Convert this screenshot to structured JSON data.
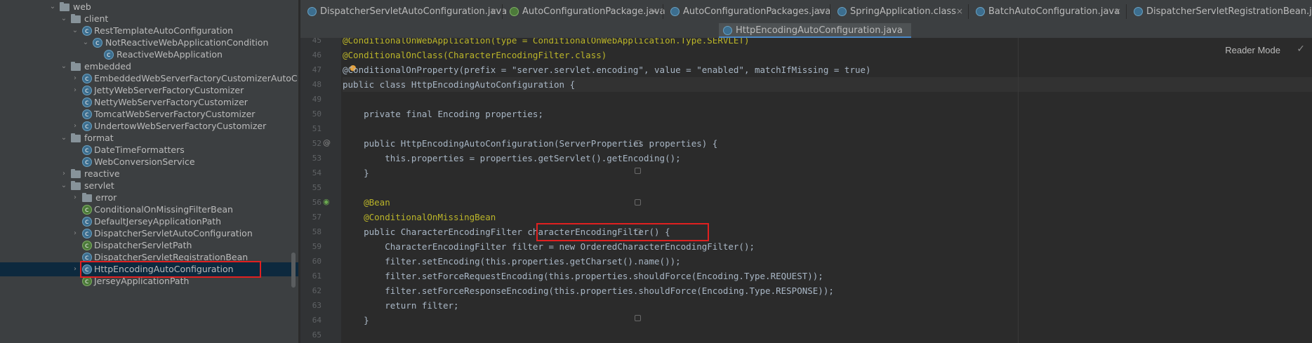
{
  "sidebar": {
    "items": [
      {
        "label": "web",
        "type": "folder",
        "expanded": true
      },
      {
        "label": "client",
        "type": "folder",
        "expanded": true
      },
      {
        "label": "RestTemplateAutoConfiguration",
        "type": "class",
        "expanded": true
      },
      {
        "label": "NotReactiveWebApplicationCondition",
        "type": "class",
        "expanded": true
      },
      {
        "label": "ReactiveWebApplication",
        "type": "class"
      },
      {
        "label": "embedded",
        "type": "folder",
        "expanded": true
      },
      {
        "label": "EmbeddedWebServerFactoryCustomizerAutoC",
        "type": "class",
        "expanded": false
      },
      {
        "label": "JettyWebServerFactoryCustomizer",
        "type": "class",
        "expanded": false
      },
      {
        "label": "NettyWebServerFactoryCustomizer",
        "type": "class"
      },
      {
        "label": "TomcatWebServerFactoryCustomizer",
        "type": "class"
      },
      {
        "label": "UndertowWebServerFactoryCustomizer",
        "type": "class",
        "expanded": false
      },
      {
        "label": "format",
        "type": "folder",
        "expanded": true
      },
      {
        "label": "DateTimeFormatters",
        "type": "class"
      },
      {
        "label": "WebConversionService",
        "type": "class"
      },
      {
        "label": "reactive",
        "type": "folder",
        "expanded": false
      },
      {
        "label": "servlet",
        "type": "folder",
        "expanded": true
      },
      {
        "label": "error",
        "type": "folder",
        "expanded": false
      },
      {
        "label": "ConditionalOnMissingFilterBean",
        "type": "class"
      },
      {
        "label": "DefaultJerseyApplicationPath",
        "type": "class"
      },
      {
        "label": "DispatcherServletAutoConfiguration",
        "type": "class",
        "expanded": false
      },
      {
        "label": "DispatcherServletPath",
        "type": "class"
      },
      {
        "label": "DispatcherServletRegistrationBean",
        "type": "class"
      },
      {
        "label": "HttpEncodingAutoConfiguration",
        "type": "class",
        "expanded": false,
        "selected": true
      },
      {
        "label": "JerseyApplicationPath",
        "type": "class"
      },
      {
        "label": "JerseyApplicationPath",
        "type": "class"
      }
    ]
  },
  "tabs": [
    {
      "label": "DispatcherServletAutoConfiguration.java"
    },
    {
      "label": "AutoConfigurationPackage.java"
    },
    {
      "label": "AutoConfigurationPackages.java"
    },
    {
      "label": "SpringApplication.class"
    },
    {
      "label": "BatchAutoConfiguration.java"
    },
    {
      "label": "DispatcherServletRegistrationBean.java"
    }
  ],
  "active_tab": {
    "label": "HttpEncodingAutoConfiguration.java"
  },
  "reader_mode": "Reader Mode",
  "code": {
    "lines": [
      {
        "n": "45",
        "text": "@ConditionalOnWebApplication(type = ConditionalOnWebApplication.Type.SERVLET)"
      },
      {
        "n": "46",
        "text": "@ConditionalOnClass(CharacterEncodingFilter.class)"
      },
      {
        "n": "47",
        "text": "@ConditionalOnProperty(prefix = \"server.servlet.encoding\", value = \"enabled\", matchIfMissing = true)"
      },
      {
        "n": "48",
        "text": "public class HttpEncodingAutoConfiguration {"
      },
      {
        "n": "49",
        "text": ""
      },
      {
        "n": "50",
        "text": "    private final Encoding properties;"
      },
      {
        "n": "51",
        "text": ""
      },
      {
        "n": "52",
        "text": "    public HttpEncodingAutoConfiguration(ServerProperties properties) {"
      },
      {
        "n": "53",
        "text": "        this.properties = properties.getServlet().getEncoding();"
      },
      {
        "n": "54",
        "text": "    }"
      },
      {
        "n": "55",
        "text": ""
      },
      {
        "n": "56",
        "text": "    @Bean"
      },
      {
        "n": "57",
        "text": "    @ConditionalOnMissingBean"
      },
      {
        "n": "58",
        "text": "    public CharacterEncodingFilter characterEncodingFilter() {"
      },
      {
        "n": "59",
        "text": "        CharacterEncodingFilter filter = new OrderedCharacterEncodingFilter();"
      },
      {
        "n": "60",
        "text": "        filter.setEncoding(this.properties.getCharset().name());"
      },
      {
        "n": "61",
        "text": "        filter.setForceRequestEncoding(this.properties.shouldForce(Encoding.Type.REQUEST));"
      },
      {
        "n": "62",
        "text": "        filter.setForceResponseEncoding(this.properties.shouldForce(Encoding.Type.RESPONSE));"
      },
      {
        "n": "63",
        "text": "        return filter;"
      },
      {
        "n": "64",
        "text": "    }"
      },
      {
        "n": "65",
        "text": ""
      }
    ]
  },
  "colors": {
    "keyword": "#cc7832",
    "annotation": "#bbb529",
    "string": "#6a8759",
    "field": "#9876aa",
    "method": "#ffc66d",
    "highlight_box": "#e02020"
  }
}
